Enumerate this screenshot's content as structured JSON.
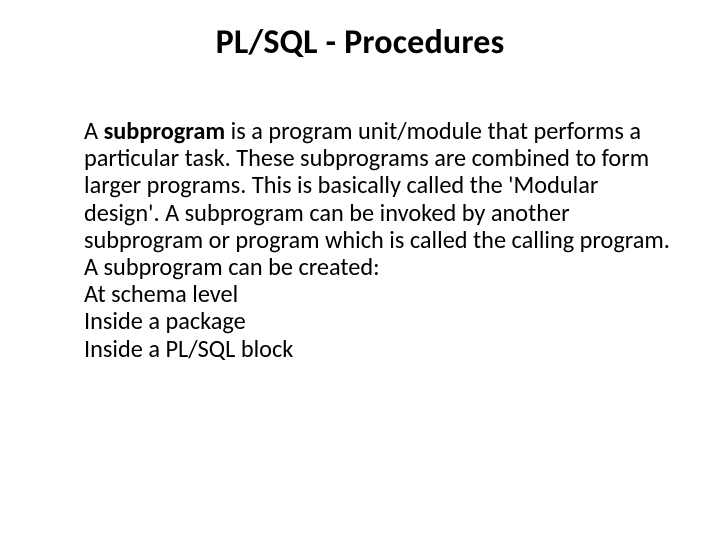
{
  "title": "PL/SQL - Procedures",
  "paragraph1": {
    "prefix": "A ",
    "bold": "subprogram",
    "rest": " is a program unit/module that performs a particular task. These subprograms are combined to form larger programs. This is basically called the 'Modular design'. A subprogram can be invoked by another subprogram or program which is called the calling program."
  },
  "lines": [
    "A subprogram can be created:",
    "At schema level",
    "Inside a package",
    "Inside a PL/SQL block"
  ]
}
